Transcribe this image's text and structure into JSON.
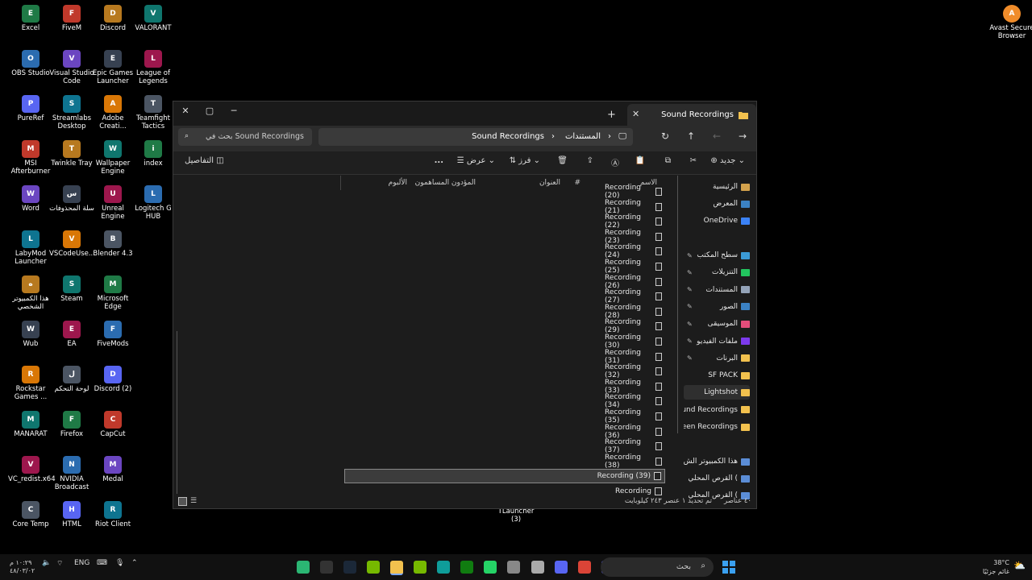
{
  "desktop": {
    "col1": [
      "Excel",
      "OBS Studio",
      "PureRef",
      "MSI Afterburner",
      "Word",
      "LabyMod Launcher",
      "هذا الكمبيوتر الشخصي",
      "Wub",
      "Rockstar Games ...",
      "MANARAT",
      "VC_redist.x64",
      "Core Temp"
    ],
    "col2": [
      "FiveM",
      "Visual Studio Code",
      "Streamlabs Desktop",
      "Twinkle Tray",
      "سلة المحذوفات",
      "VSCodeUse...",
      "Steam",
      "EA",
      "لوحة التحكم",
      "Firefox",
      "NVIDIA Broadcast",
      "HTML"
    ],
    "col3": [
      "Discord",
      "Epic Games Launcher",
      "Adobe Creati...",
      "Wallpaper Engine",
      "Unreal Engine",
      "Blender 4.3",
      "Microsoft Edge",
      "FiveMods",
      "Discord (2)",
      "CapCut",
      "Medal",
      "Riot Client"
    ],
    "col4": [
      "VALORANT",
      "League of Legends",
      "Teamfight Tactics",
      "index",
      "Logitech G HUB"
    ],
    "right_icon": "Avast Secure Browser",
    "center_icon": "TLauncher (3)"
  },
  "explorer": {
    "tab_title": "Sound Recordings",
    "breadcrumb": [
      "المستندات",
      "Sound Recordings"
    ],
    "search_placeholder": "بحث في Sound Recordings",
    "toolbar": {
      "new": "جديد",
      "sort": "فرز",
      "view": "عرض",
      "more": "...",
      "details": "التفاصيل"
    },
    "columns": {
      "name": "الاسم",
      "num": "#",
      "title": "العنوان",
      "artists": "المؤدون المساهمون",
      "album": "الألبوم"
    },
    "files": [
      "Recording (20)",
      "Recording (21)",
      "Recording (22)",
      "Recording (23)",
      "Recording (24)",
      "Recording (25)",
      "Recording (26)",
      "Recording (27)",
      "Recording (28)",
      "Recording (29)",
      "Recording (30)",
      "Recording (31)",
      "Recording (32)",
      "Recording (33)",
      "Recording (34)",
      "Recording (35)",
      "Recording (36)",
      "Recording (37)",
      "Recording (38)",
      "Recording (39)",
      "Recording"
    ],
    "selected_file": "Recording (39)",
    "sidebar": {
      "top": [
        "الرئيسية",
        "المعرض",
        "OneDrive"
      ],
      "pinned": [
        "سطح المكتب",
        "التنزيلات",
        "المستندات",
        "الصور",
        "الموسيقى",
        "ملفات الفيديو",
        "البرنات"
      ],
      "folders": [
        "SF PACK",
        "Lightshot",
        "und Recordings",
        "reen Recordings"
      ],
      "bottom": [
        "هذا الكمبيوتر الش",
        "القرص المحلي (",
        "القرص المحلي ("
      ]
    },
    "status": {
      "count": "٤٠ عناصر",
      "selection": "تم تحديد ١ عنصر   ٢٤٣ كيلوبايت"
    }
  },
  "taskbar": {
    "search_placeholder": "بحث",
    "lang": "ENG",
    "time": "١٠:٢٩ م",
    "date": "٤٨/٠٣/٠٢",
    "weather_temp": "38°C",
    "weather_text": "غائم جزئيًا"
  }
}
